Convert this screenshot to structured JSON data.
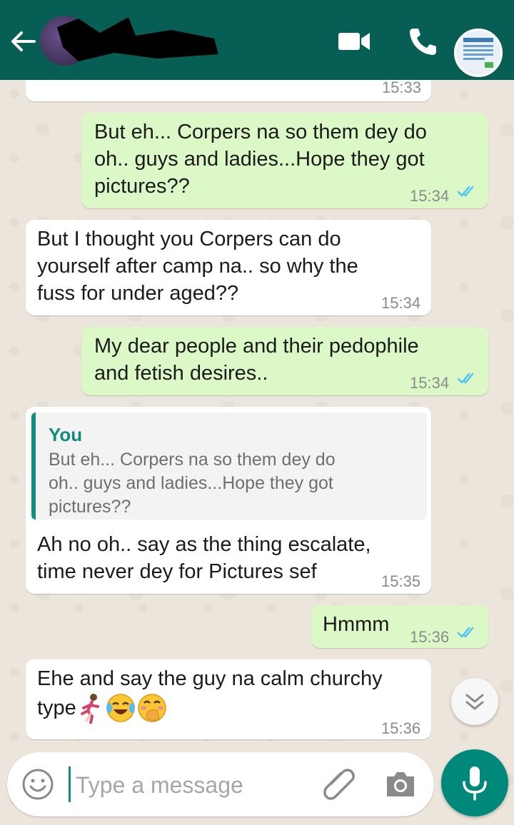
{
  "header": {
    "back_icon": "arrow-left-icon",
    "video_icon": "video-call-icon",
    "call_icon": "phone-icon"
  },
  "messages": [
    {
      "direction": "incoming",
      "text": "",
      "time": "15:33",
      "partial": true
    },
    {
      "direction": "outgoing",
      "text": "But eh... Corpers na so them dey do\noh.. guys and ladies...Hope they got\npictures??",
      "time": "15:34",
      "status": "read"
    },
    {
      "direction": "incoming",
      "text": "But I thought you Corpers can do\nyourself after camp na.. so why the\nfuss for under aged??",
      "time": "15:34"
    },
    {
      "direction": "outgoing",
      "text": "My dear people and their pedophile\nand fetish desires..",
      "time": "15:34",
      "status": "read"
    },
    {
      "direction": "incoming",
      "quote": {
        "author": "You",
        "text": "But eh... Corpers na so them dey do\noh.. guys and ladies...Hope they got\npictures??"
      },
      "text": "Ah no oh.. say as the thing escalate,\ntime never dey for Pictures sef",
      "time": "15:35"
    },
    {
      "direction": "outgoing",
      "text": "Hmmm",
      "time": "15:36",
      "status": "read"
    },
    {
      "direction": "incoming",
      "text_line1": "Ehe and say the guy na calm churchy",
      "text_line2": "type",
      "emojis": [
        "runner-woman",
        "tears-of-joy",
        "hand-over-mouth"
      ],
      "time": "15:36"
    }
  ],
  "composer": {
    "placeholder": "Type a message",
    "emoji_icon": "smiley-icon",
    "attach_icon": "paperclip-icon",
    "camera_icon": "camera-icon",
    "mic_icon": "microphone-icon"
  },
  "scroll_icon": "double-chevron-down-icon",
  "colors": {
    "header": "#075e54",
    "outgoing_bubble": "#dcf8c6",
    "incoming_bubble": "#ffffff",
    "read_tick": "#4fc3f7",
    "accent": "#128c7e",
    "mic_button": "#00897b"
  }
}
